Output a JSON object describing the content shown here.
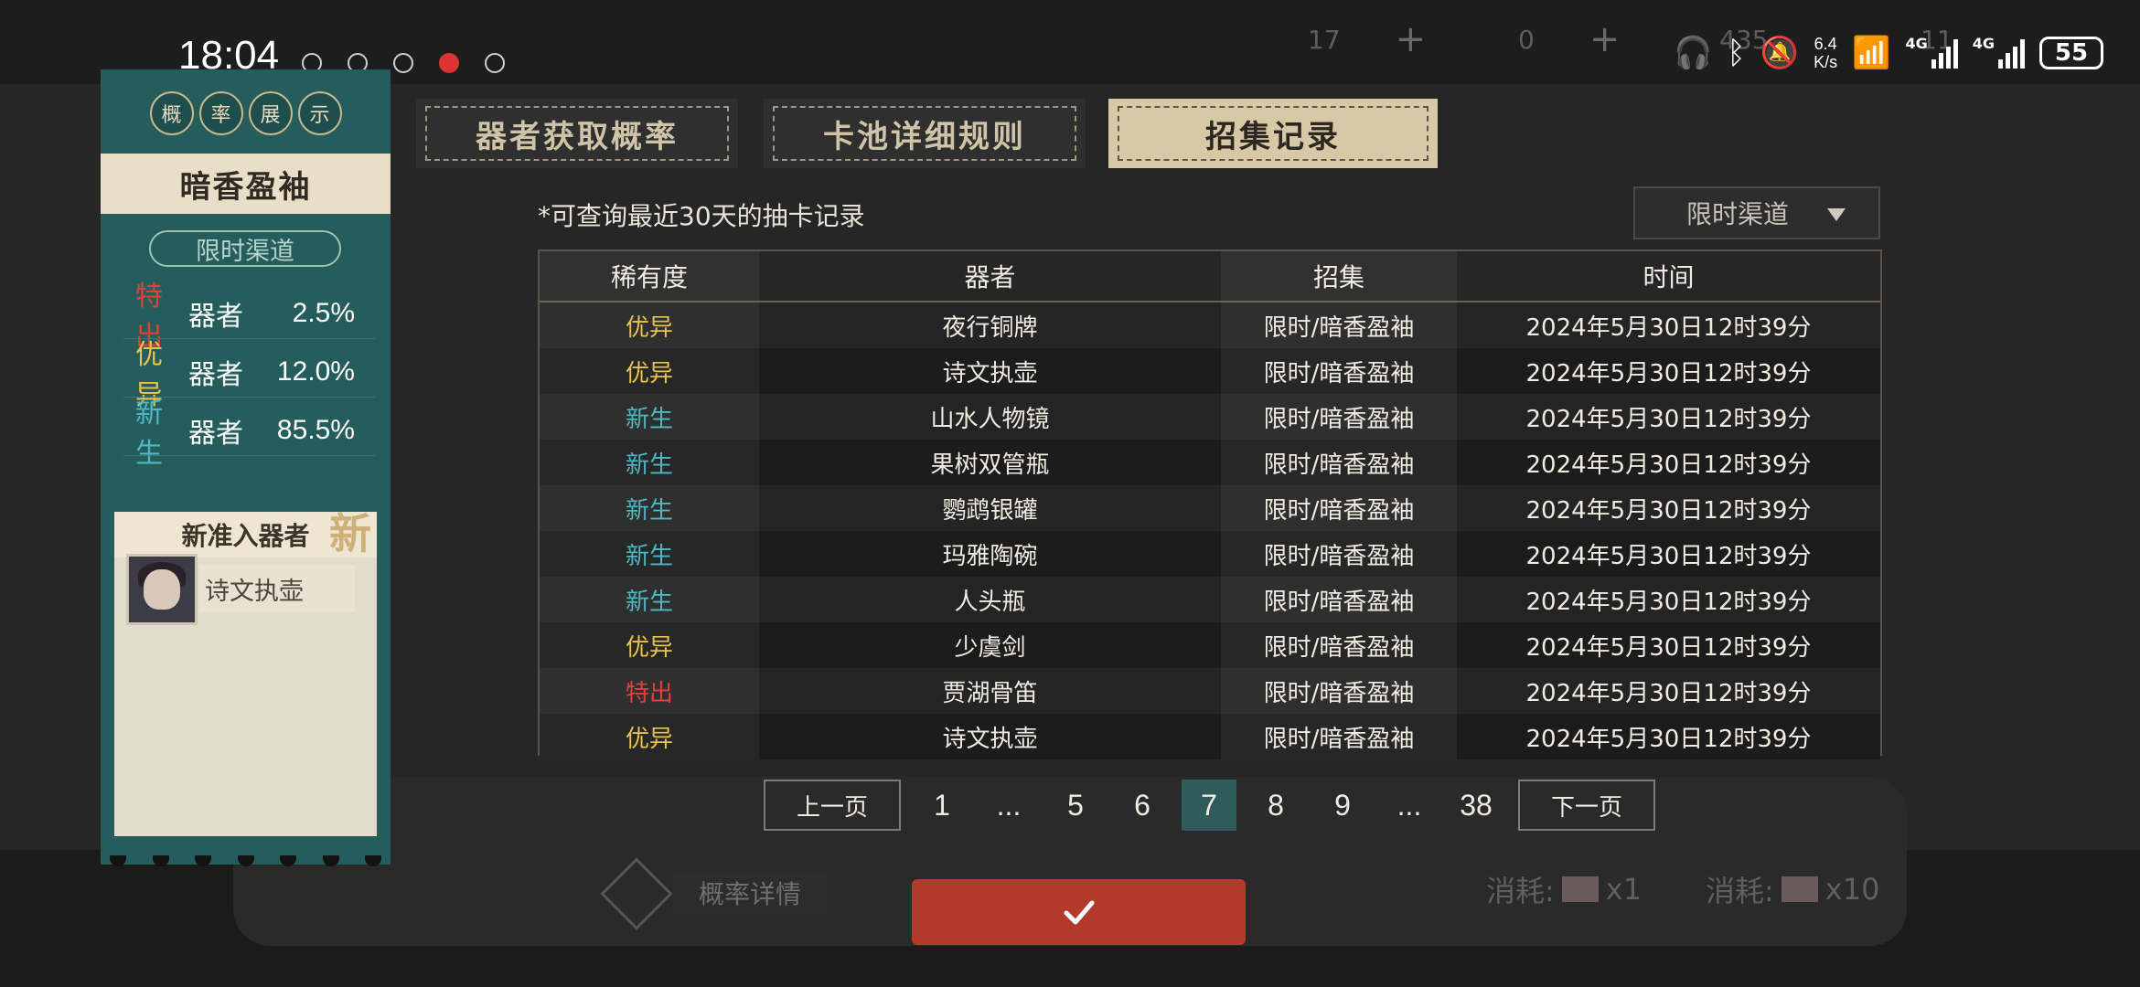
{
  "status_bar": {
    "time": "18:04",
    "net_speed_value": "6.4",
    "net_speed_unit": "K/s",
    "network_1": "4G",
    "network_2": "4G",
    "battery": "55"
  },
  "background": {
    "resource_values": [
      "17",
      "0",
      "435",
      "11"
    ],
    "probability_detail": "概率详情",
    "cost_single": "消耗:",
    "cost_single_mult": "x1",
    "cost_ten": "消耗:",
    "cost_ten_mult": "x10"
  },
  "left_panel": {
    "badges": [
      "概",
      "率",
      "展",
      "示"
    ],
    "banner_name": "暗香盈袖",
    "channel": "限时渠道",
    "rates": [
      {
        "label": "特出",
        "name": "器者",
        "value": "2.5%",
        "color": "#e0403a"
      },
      {
        "label": "优异",
        "name": "器者",
        "value": "12.0%",
        "color": "#e8c24a"
      },
      {
        "label": "新生",
        "name": "器者",
        "value": "85.5%",
        "color": "#4fb6c6"
      }
    ],
    "new_title": "新准入器者",
    "new_mark": "新",
    "new_character": "诗文执壶"
  },
  "tabs": [
    {
      "label": "器者获取概率",
      "active": false
    },
    {
      "label": "卡池详细规则",
      "active": false
    },
    {
      "label": "招集记录",
      "active": true
    }
  ],
  "notice": "*可查询最近30天的抽卡记录",
  "channel_filter": "限时渠道",
  "table": {
    "headers": [
      "稀有度",
      "器者",
      "招集",
      "时间"
    ],
    "rows": [
      {
        "rarity": "优异",
        "rarity_color": "#e8c24a",
        "name": "夜行铜牌",
        "pool": "限时/暗香盈袖",
        "time": "2024年5月30日12时39分"
      },
      {
        "rarity": "优异",
        "rarity_color": "#e8c24a",
        "name": "诗文执壶",
        "pool": "限时/暗香盈袖",
        "time": "2024年5月30日12时39分"
      },
      {
        "rarity": "新生",
        "rarity_color": "#4fb6c6",
        "name": "山水人物镜",
        "pool": "限时/暗香盈袖",
        "time": "2024年5月30日12时39分"
      },
      {
        "rarity": "新生",
        "rarity_color": "#4fb6c6",
        "name": "果树双管瓶",
        "pool": "限时/暗香盈袖",
        "time": "2024年5月30日12时39分"
      },
      {
        "rarity": "新生",
        "rarity_color": "#4fb6c6",
        "name": "鹦鹉银罐",
        "pool": "限时/暗香盈袖",
        "time": "2024年5月30日12时39分"
      },
      {
        "rarity": "新生",
        "rarity_color": "#4fb6c6",
        "name": "玛雅陶碗",
        "pool": "限时/暗香盈袖",
        "time": "2024年5月30日12时39分"
      },
      {
        "rarity": "新生",
        "rarity_color": "#4fb6c6",
        "name": "人头瓶",
        "pool": "限时/暗香盈袖",
        "time": "2024年5月30日12时39分"
      },
      {
        "rarity": "优异",
        "rarity_color": "#e8c24a",
        "name": "少虞剑",
        "pool": "限时/暗香盈袖",
        "time": "2024年5月30日12时39分"
      },
      {
        "rarity": "特出",
        "rarity_color": "#e0403a",
        "name": "贾湖骨笛",
        "pool": "限时/暗香盈袖",
        "time": "2024年5月30日12时39分"
      },
      {
        "rarity": "优异",
        "rarity_color": "#e8c24a",
        "name": "诗文执壶",
        "pool": "限时/暗香盈袖",
        "time": "2024年5月30日12时39分"
      }
    ]
  },
  "pagination": {
    "prev": "上一页",
    "next": "下一页",
    "pages": [
      "1",
      "...",
      "5",
      "6",
      "7",
      "8",
      "9",
      "...",
      "38"
    ],
    "current": "7"
  }
}
